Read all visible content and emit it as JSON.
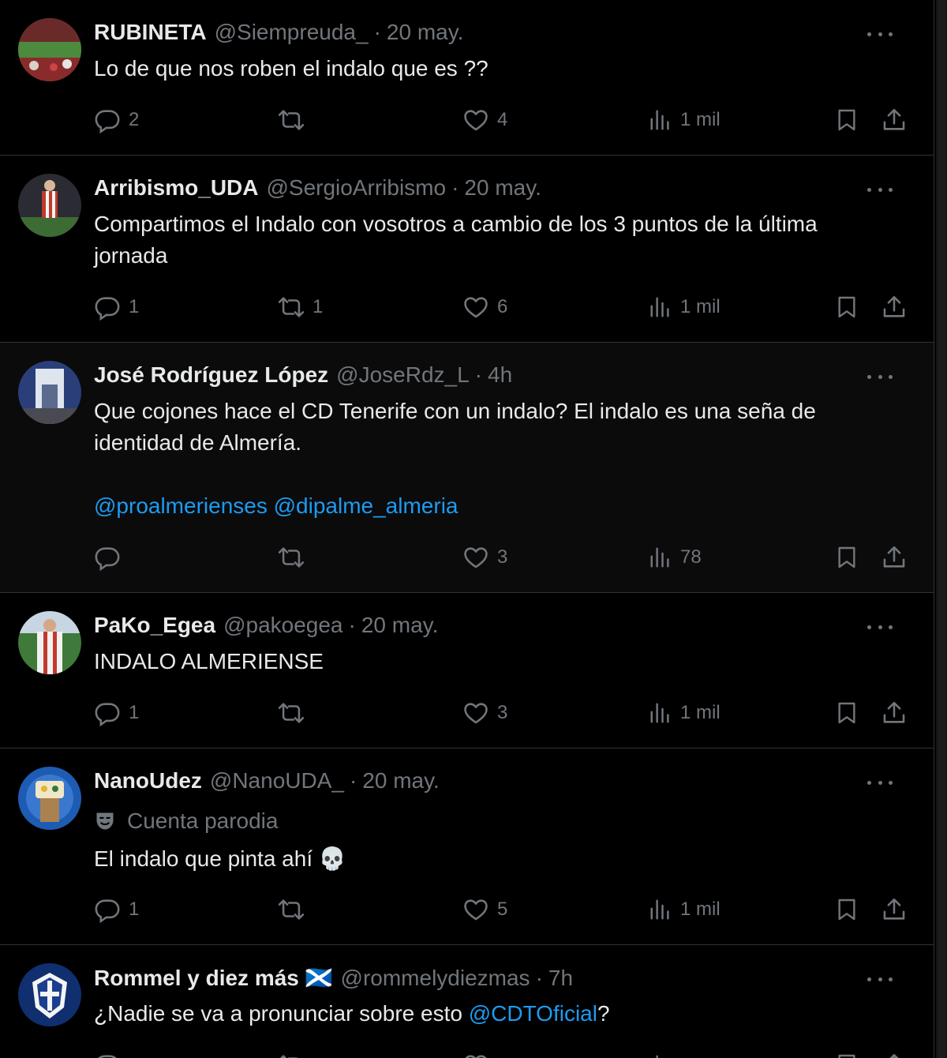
{
  "tweets": [
    {
      "name": "RUBINETA",
      "handle": "@Siempreuda_",
      "sep": "·",
      "time": "20 may.",
      "text": "Lo de que nos roben el indalo que es ??",
      "replies": "2",
      "retweets": "",
      "likes": "4",
      "views": "1 mil"
    },
    {
      "name": "Arribismo_UDA",
      "handle": "@SergioArribismo",
      "sep": "·",
      "time": "20 may.",
      "text": "Compartimos el Indalo con vosotros a cambio de los 3 puntos de la última jornada",
      "replies": "1",
      "retweets": "1",
      "likes": "6",
      "views": "1 mil"
    },
    {
      "name": "José Rodríguez López",
      "handle": "@JoseRdz_L",
      "sep": "·",
      "time": "4h",
      "text": "Que cojones hace el CD Tenerife con un indalo? El indalo es una seña de identidad de Almería.",
      "mention_1": "@proalmerienses",
      "mention_2": "@dipalme_almeria",
      "replies": "",
      "retweets": "",
      "likes": "3",
      "views": "78"
    },
    {
      "name": "PaKo_Egea",
      "handle": "@pakoegea",
      "sep": "·",
      "time": "20 may.",
      "text": "INDALO ALMERIENSE",
      "replies": "1",
      "retweets": "",
      "likes": "3",
      "views": "1 mil"
    },
    {
      "name": "NanoUdez",
      "handle": "@NanoUDA_",
      "sep": "·",
      "time": "20 may.",
      "label": "Cuenta parodia",
      "text": "El indalo que pinta ahí 💀",
      "replies": "1",
      "retweets": "",
      "likes": "5",
      "views": "1 mil"
    },
    {
      "name": "Rommel y diez más 🏴󠁧󠁢󠁳󠁣󠁴󠁿",
      "handle": "@rommelydiezmas",
      "sep": "·",
      "time": "7h",
      "text_before": "¿Nadie se va a pronunciar sobre esto ",
      "mention": "@CDTOficial",
      "text_after": "?"
    }
  ]
}
